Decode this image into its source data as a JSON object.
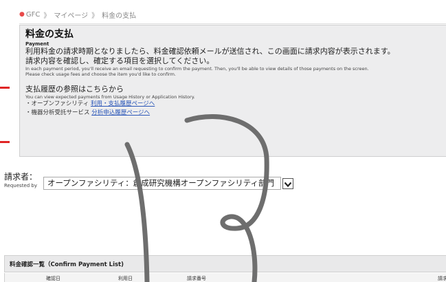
{
  "breadcrumb": {
    "items": [
      "GFC",
      "マイページ",
      "料金の支払"
    ],
    "separator": "》"
  },
  "payment": {
    "title": "料金の支払",
    "subtitle": "Payment",
    "jp_line1": "利用料金の請求時期となりましたら、料金確認依頼メールが送信され、この画面に請求内容が表示されます。",
    "jp_line2": "請求内容を確認し、確定する項目を選択してください。",
    "en_line1": "In each payment period, you'll receive an email requesting to confirm the payment. Then, you'll be able to view details of those payments on the screen.",
    "en_line2": "Please check usage fees and choose the item you'd like to confirm.",
    "history": {
      "heading": "支払履歴の参照はこちらから",
      "en": "You can view expected payments from Usage History or Application History.",
      "item1_label": "・オープンファシリティ",
      "item1_link": "利用・支払履歴ページへ",
      "item2_label": "・機器分析受託サービス",
      "item2_link": "分析申込履歴ページへ"
    }
  },
  "requester": {
    "label": "請求者：",
    "label_en": "Requested by",
    "selected": "オープンファシリティ：創成研究機構オープンファシリティ部門"
  },
  "confirm_list": {
    "title": "料金確認一覧（Confirm Payment List)",
    "columns": [
      "確認日",
      "利用日",
      "請求番号",
      "請求"
    ]
  },
  "colors": {
    "accent_red": "#e02525",
    "breadcrumb_dot": "#e84a4a",
    "link": "#2a56b8",
    "panel_bg": "#ededee",
    "scribble": "#6e6e6e"
  }
}
